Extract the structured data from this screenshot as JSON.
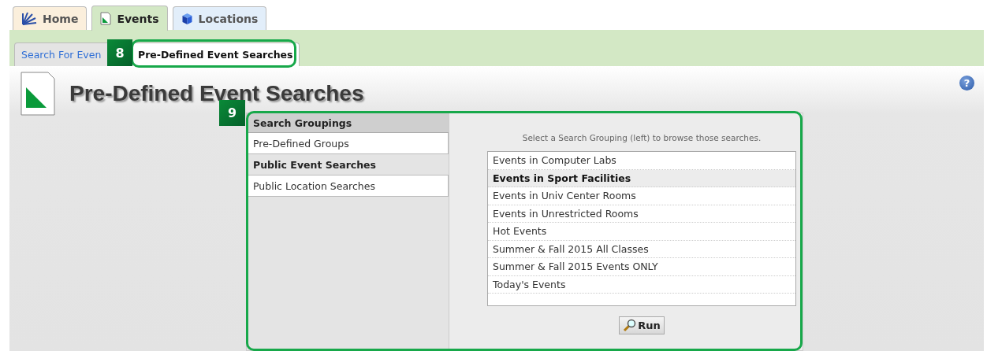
{
  "tabs": [
    {
      "label": "Home",
      "selected": false
    },
    {
      "label": "Events",
      "selected": true
    },
    {
      "label": "Locations",
      "selected": false
    }
  ],
  "subtabs": [
    {
      "label": "Search For Even",
      "selected": false
    },
    {
      "label": "Pre-Defined Event Searches",
      "selected": true
    }
  ],
  "page_title": "Pre-Defined Event Searches",
  "help_label": "?",
  "groupings": {
    "header": "Search Groupings",
    "items": [
      {
        "label": "Pre-Defined Groups",
        "selected": false
      },
      {
        "label": "Public Event Searches",
        "selected": true
      },
      {
        "label": "Public Location Searches",
        "selected": false
      }
    ]
  },
  "searches": {
    "hint": "Select a Search Grouping (left) to browse those searches.",
    "items": [
      {
        "label": "Events in Computer Labs",
        "selected": false
      },
      {
        "label": "Events in Sport Facilities",
        "selected": true
      },
      {
        "label": "Events in Univ Center Rooms",
        "selected": false
      },
      {
        "label": "Events in Unrestricted Rooms",
        "selected": false
      },
      {
        "label": "Hot Events",
        "selected": false
      },
      {
        "label": "Summer & Fall 2015 All Classes",
        "selected": false
      },
      {
        "label": "Summer & Fall 2015 Events ONLY",
        "selected": false
      },
      {
        "label": "Today's Events",
        "selected": false
      }
    ]
  },
  "run_button": "Run",
  "callouts": [
    {
      "label": "8"
    },
    {
      "label": "9"
    }
  ]
}
